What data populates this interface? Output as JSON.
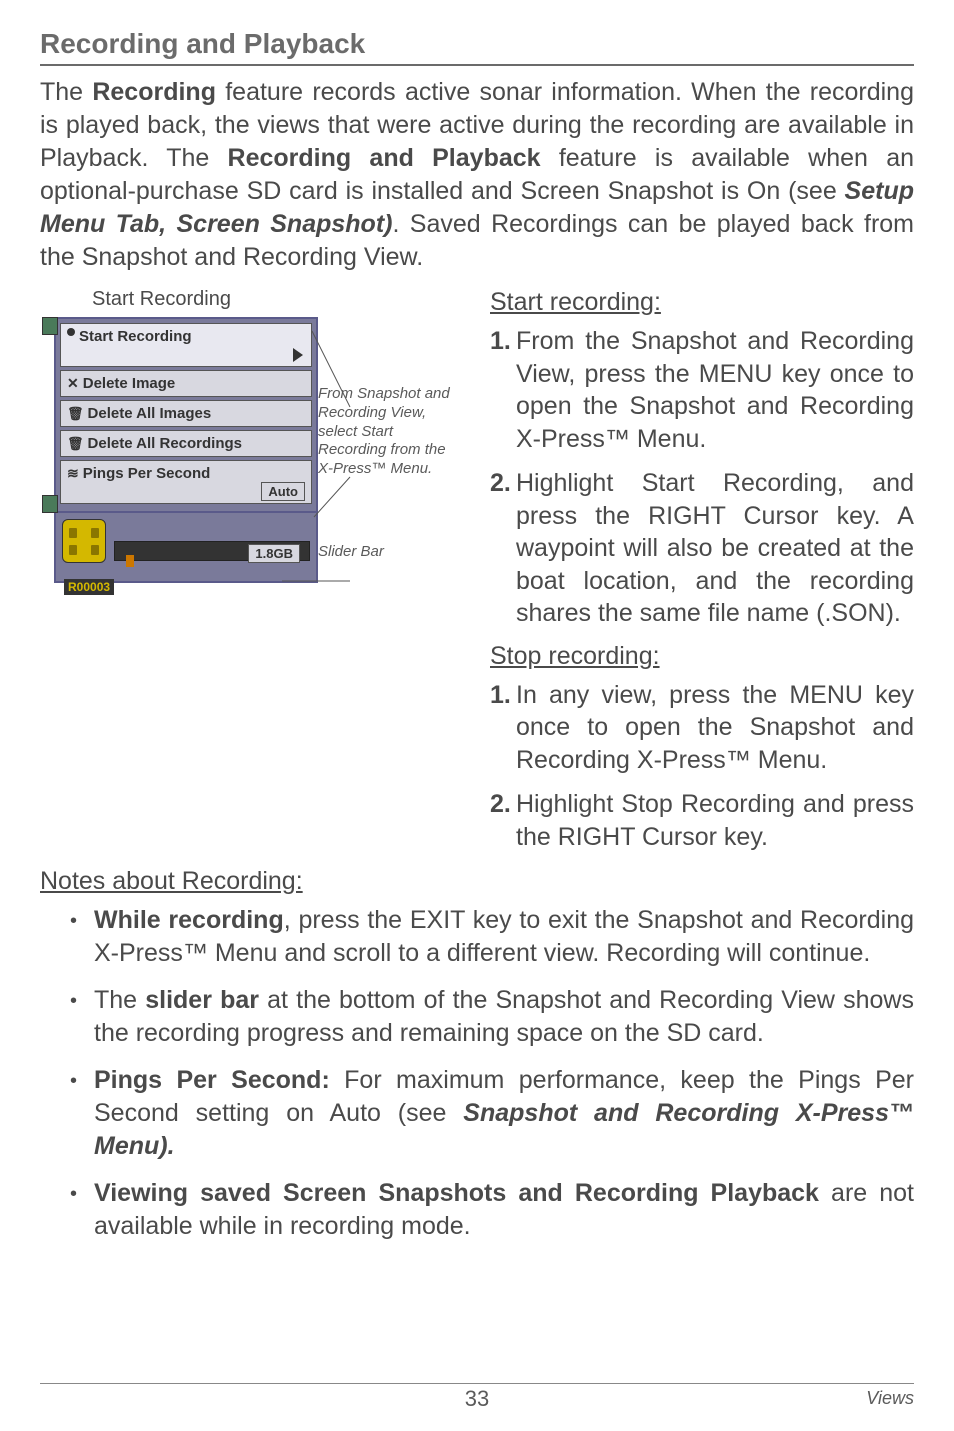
{
  "section_title": "Recording and Playback",
  "intro": {
    "part1": "The ",
    "bold1": "Recording",
    "part2": " feature records active sonar information. When the recording is played back, the views that were active during the recording are available in Playback. The ",
    "bold2": "Recording and Playback",
    "part3": " feature is available when an optional-purchase SD card is installed and Screen Snapshot is On (see ",
    "italic1": "Setup Menu Tab, Screen Snapshot)",
    "part4": ". Saved Recordings can be played back from the Snapshot and Recording View."
  },
  "figure": {
    "title": "Start Recording",
    "menu_items": {
      "start_recording": "Start Recording",
      "delete_image": "Delete Image",
      "delete_all_images": "Delete All Images",
      "delete_all_recordings": "Delete All Recordings",
      "pings_per_second": "Pings Per Second",
      "auto": "Auto"
    },
    "slider": {
      "value": "1.8GB",
      "rec_id": "R00003"
    },
    "callout1": "From Snapshot and Recording View, select Start Recording from the X-Press™ Menu.",
    "callout2": "Slider Bar"
  },
  "start_recording": {
    "heading": "Start recording:",
    "item1_num": "1.",
    "item1_text": "From the Snapshot and Recording View, press the MENU key once to open the Snapshot and Recording X-Press™ Menu.",
    "item2_num": "2.",
    "item2_text": "Highlight Start Recording, and press the RIGHT Cursor key. A waypoint will also be created at the boat location, and the recording shares the same file name (.SON)."
  },
  "stop_recording": {
    "heading": "Stop recording:",
    "item1_num": "1.",
    "item1_text": "In any view, press the MENU key once to open the Snapshot and Recording X-Press™ Menu.",
    "item2_num": "2.",
    "item2_text": "Highlight Stop Recording and press the RIGHT Cursor key."
  },
  "notes": {
    "heading": "Notes about Recording:",
    "b1_bold": "While recording",
    "b1_text": ", press the EXIT key to exit the Snapshot and Recording X-Press™ Menu and scroll to a different view. Recording will continue.",
    "b2_pre": "The ",
    "b2_bold": "slider bar",
    "b2_text": " at the bottom of the Snapshot and Recording View shows the recording progress and remaining space on the SD card.",
    "b3_bold": "Pings Per Second:",
    "b3_text": " For maximum performance, keep the Pings Per Second setting on Auto (see ",
    "b3_italic": "Snapshot and Recording X-Press™ Menu).",
    "b4_bold": "Viewing saved Screen Snapshots and Recording Playback",
    "b4_text": " are not available while in recording mode."
  },
  "footer": {
    "page": "33",
    "section": "Views"
  }
}
